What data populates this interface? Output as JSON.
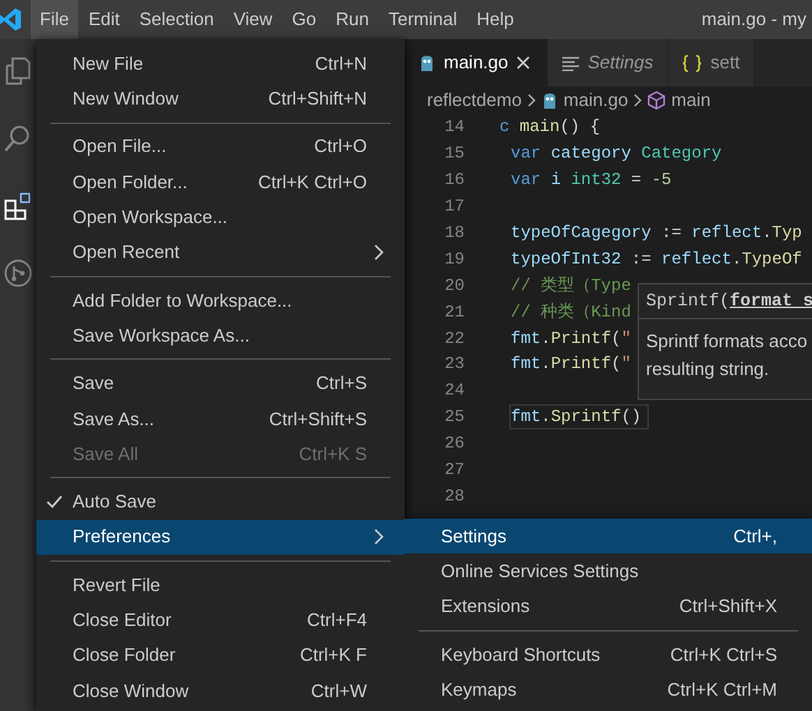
{
  "title_bar": {
    "menus": [
      {
        "label": "File",
        "selected": true
      },
      {
        "label": "Edit",
        "selected": false
      },
      {
        "label": "Selection",
        "selected": false
      },
      {
        "label": "View",
        "selected": false
      },
      {
        "label": "Go",
        "selected": false
      },
      {
        "label": "Run",
        "selected": false
      },
      {
        "label": "Terminal",
        "selected": false
      },
      {
        "label": "Help",
        "selected": false
      }
    ],
    "title": "main.go - my"
  },
  "activity_bar": [
    {
      "kind": "files",
      "selected": false
    },
    {
      "kind": "search",
      "selected": false
    },
    {
      "kind": "extensions",
      "selected": true
    },
    {
      "kind": "source",
      "selected": false
    }
  ],
  "tabs": [
    {
      "label": "main.go",
      "kind": "go",
      "selected": true
    },
    {
      "label": "Settings",
      "kind": "settings",
      "selected": false
    },
    {
      "label": "sett",
      "kind": "json",
      "selected": false
    }
  ],
  "breadcrumb": [
    {
      "label": "reflectdemo",
      "kind": "folder"
    },
    {
      "label": "main.go",
      "kind": "go"
    },
    {
      "label": "main",
      "kind": "symbol"
    }
  ],
  "code_lines": [
    {
      "number": "14",
      "current": false,
      "tokens": [
        {
          "text": "c ",
          "kind": "keyword"
        },
        {
          "text": "main",
          "kind": "function"
        },
        {
          "text": "() {",
          "kind": "plain"
        }
      ],
      "children": [
        {
          "number": "15",
          "current": false,
          "tokens": [
            {
              "text": "var ",
              "kind": "keyword"
            },
            {
              "text": "category ",
              "kind": "variable"
            },
            {
              "text": "Category",
              "kind": "type"
            }
          ]
        },
        {
          "number": "16",
          "current": false,
          "tokens": [
            {
              "text": "var ",
              "kind": "keyword"
            },
            {
              "text": "i ",
              "kind": "variable"
            },
            {
              "text": "int32",
              "kind": "type"
            },
            {
              "text": " = ",
              "kind": "plain"
            },
            {
              "text": "-5",
              "kind": "number"
            }
          ]
        },
        {
          "number": "17",
          "current": false
        },
        {
          "number": "18",
          "current": false,
          "tokens": [
            {
              "text": "typeOfCagegory",
              "kind": "variable"
            },
            {
              "text": " := ",
              "kind": "plain"
            },
            {
              "text": "reflect",
              "kind": "variable"
            },
            {
              "text": ".",
              "kind": "plain"
            },
            {
              "text": "Typ",
              "kind": "function"
            }
          ]
        },
        {
          "number": "19",
          "current": false,
          "tokens": [
            {
              "text": "typeOfInt32",
              "kind": "variable"
            },
            {
              "text": " := ",
              "kind": "plain"
            },
            {
              "text": "reflect",
              "kind": "variable"
            },
            {
              "text": ".",
              "kind": "plain"
            },
            {
              "text": "TypeOf",
              "kind": "function"
            }
          ]
        },
        {
          "number": "20",
          "current": false,
          "tokens": [
            {
              "text": "// 类型（Type",
              "kind": "comment"
            }
          ]
        },
        {
          "number": "21",
          "current": false,
          "tokens": [
            {
              "text": "// 种类（Kind",
              "kind": "comment"
            }
          ]
        },
        {
          "number": "22",
          "current": false,
          "tokens": [
            {
              "text": "fmt",
              "kind": "variable"
            },
            {
              "text": ".",
              "kind": "plain"
            },
            {
              "text": "Printf",
              "kind": "function"
            },
            {
              "text": "(",
              "kind": "plain"
            },
            {
              "text": "\"",
              "kind": "string"
            }
          ]
        },
        {
          "number": "23",
          "current": false,
          "tokens": [
            {
              "text": "fmt",
              "kind": "variable"
            },
            {
              "text": ".",
              "kind": "plain"
            },
            {
              "text": "Printf",
              "kind": "function"
            },
            {
              "text": "(",
              "kind": "plain"
            },
            {
              "text": "\"",
              "kind": "string"
            }
          ]
        },
        {
          "number": "24",
          "current": false
        },
        {
          "number": "25",
          "current": true,
          "tokens": [
            {
              "text": "fmt",
              "kind": "variable"
            },
            {
              "text": ".",
              "kind": "plain"
            },
            {
              "text": "Sprintf",
              "kind": "function"
            },
            {
              "text": "()",
              "kind": "plain"
            }
          ]
        },
        {
          "number": "26",
          "current": false
        },
        {
          "number": "27",
          "current": false
        },
        {
          "number": "28",
          "current": false
        }
      ]
    }
  ],
  "hover": {
    "signature": "Sprintf(",
    "parameter": "format s",
    "doc": [
      "Sprintf formats acco",
      "resulting string."
    ]
  },
  "file_menu": [
    {
      "kind": "item",
      "label": "New File",
      "shortcut": "Ctrl+N",
      "disabled": false,
      "checked": false,
      "selected": false,
      "submenu": false
    },
    {
      "kind": "item",
      "label": "New Window",
      "shortcut": "Ctrl+Shift+N",
      "disabled": false,
      "checked": false,
      "selected": false,
      "submenu": false
    },
    {
      "kind": "separator"
    },
    {
      "kind": "item",
      "label": "Open File...",
      "shortcut": "Ctrl+O",
      "disabled": false,
      "checked": false,
      "selected": false,
      "submenu": false
    },
    {
      "kind": "item",
      "label": "Open Folder...",
      "shortcut": "Ctrl+K Ctrl+O",
      "disabled": false,
      "checked": false,
      "selected": false,
      "submenu": false
    },
    {
      "kind": "item",
      "label": "Open Workspace...",
      "disabled": false,
      "checked": false,
      "selected": false,
      "submenu": false
    },
    {
      "kind": "item",
      "label": "Open Recent",
      "disabled": false,
      "checked": false,
      "selected": false,
      "submenu": true
    },
    {
      "kind": "separator"
    },
    {
      "kind": "item",
      "label": "Add Folder to Workspace...",
      "disabled": false,
      "checked": false,
      "selected": false,
      "submenu": false
    },
    {
      "kind": "item",
      "label": "Save Workspace As...",
      "disabled": false,
      "checked": false,
      "selected": false,
      "submenu": false
    },
    {
      "kind": "separator"
    },
    {
      "kind": "item",
      "label": "Save",
      "shortcut": "Ctrl+S",
      "disabled": false,
      "checked": false,
      "selected": false,
      "submenu": false
    },
    {
      "kind": "item",
      "label": "Save As...",
      "shortcut": "Ctrl+Shift+S",
      "disabled": false,
      "checked": false,
      "selected": false,
      "submenu": false
    },
    {
      "kind": "item",
      "label": "Save All",
      "shortcut": "Ctrl+K S",
      "disabled": true,
      "checked": false,
      "selected": false,
      "submenu": false
    },
    {
      "kind": "separator"
    },
    {
      "kind": "item",
      "label": "Auto Save",
      "disabled": false,
      "checked": true,
      "selected": false,
      "submenu": false
    },
    {
      "kind": "item",
      "label": "Preferences",
      "disabled": false,
      "checked": false,
      "selected": true,
      "submenu": true
    },
    {
      "kind": "separator"
    },
    {
      "kind": "item",
      "label": "Revert File",
      "disabled": false,
      "checked": false,
      "selected": false,
      "submenu": false
    },
    {
      "kind": "item",
      "label": "Close Editor",
      "shortcut": "Ctrl+F4",
      "disabled": false,
      "checked": false,
      "selected": false,
      "submenu": false
    },
    {
      "kind": "item",
      "label": "Close Folder",
      "shortcut": "Ctrl+K F",
      "disabled": false,
      "checked": false,
      "selected": false,
      "submenu": false
    },
    {
      "kind": "item",
      "label": "Close Window",
      "shortcut": "Ctrl+W",
      "disabled": false,
      "checked": false,
      "selected": false,
      "submenu": false
    }
  ],
  "preferences_menu": [
    {
      "kind": "item",
      "label": "Settings",
      "shortcut": "Ctrl+,",
      "selected": true
    },
    {
      "kind": "item",
      "label": "Online Services Settings",
      "selected": false
    },
    {
      "kind": "item",
      "label": "Extensions",
      "shortcut": "Ctrl+Shift+X",
      "selected": false
    },
    {
      "kind": "separator"
    },
    {
      "kind": "item",
      "label": "Keyboard Shortcuts",
      "shortcut": "Ctrl+K Ctrl+S",
      "selected": false
    },
    {
      "kind": "item",
      "label": "Keymaps",
      "shortcut": "Ctrl+K Ctrl+M",
      "selected": false
    }
  ]
}
